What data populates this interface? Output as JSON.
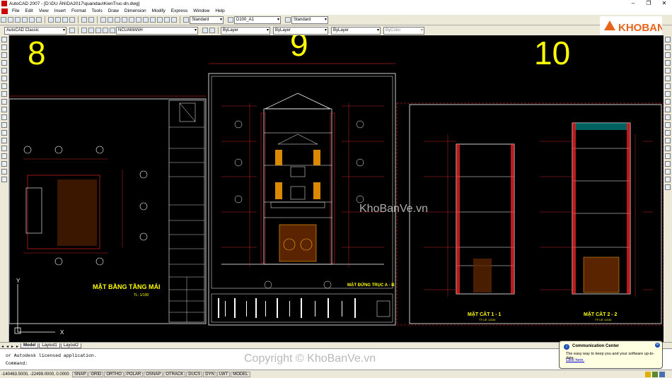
{
  "window": {
    "title": "AutoCAD 2007 - [D:\\DU ÁN\\DA2017\\quandau\\KienTruc-dn.dwg]"
  },
  "menu": [
    "File",
    "Edit",
    "View",
    "Insert",
    "Format",
    "Tools",
    "Draw",
    "Dimension",
    "Modify",
    "Express",
    "Window",
    "Help"
  ],
  "toolbar": {
    "text_style": "Standard",
    "dim_style": "D100_A1",
    "table_style": "Standard",
    "workspace": "AutoCAD Classic",
    "layer": "NCUAMANH",
    "color": "ByLayer",
    "linetype": "ByLayer",
    "lineweight": "ByLayer",
    "plotstyle": "ByColor"
  },
  "drawing": {
    "sheet_numbers": [
      "8",
      "9",
      "10"
    ],
    "labels": {
      "roof_plan": "MẶT BẰNG TẦNG MÁI",
      "roof_scale": "TL: 1/100",
      "elevation": "MẶT ĐỨNG TRỤC A - B",
      "section1": "MẶT CẮT 1 - 1",
      "section2": "MẶT CẮT 2 - 2",
      "section_scale": "TỶ LỆ: 1/100"
    },
    "watermark": "KhoBanVe.vn"
  },
  "logo": {
    "text": "KHOBANVE"
  },
  "tabs": [
    "Model",
    "Layout1",
    "Layout2"
  ],
  "command_line": {
    "line1": "or Autodesk licensed application.",
    "line2": "Command:"
  },
  "status": {
    "coordinates": "-140463.5000, -22499.0000, 0.0000",
    "buttons": [
      "SNAP",
      "GRID",
      "ORTHO",
      "POLAR",
      "OSNAP",
      "OTRACK",
      "DUCS",
      "DYN",
      "LWT",
      "MODEL"
    ]
  },
  "balloon": {
    "title": "Communication Center",
    "message": "The easy way to keep you and your software up-to-date.",
    "link": "Click here."
  },
  "copyright": "Copyright © KhoBanVe.vn",
  "colors": {
    "accent_yellow": "#ffff00",
    "line_red": "#ff2a2a",
    "line_white": "#ffffff"
  }
}
